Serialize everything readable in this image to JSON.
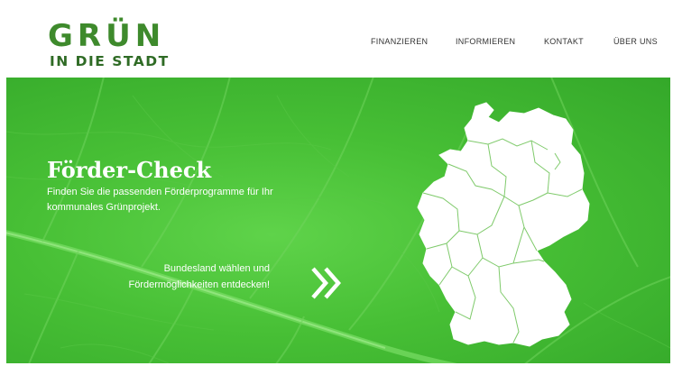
{
  "brand": {
    "line1": "GRÜN",
    "line2": "IN DIE STADT"
  },
  "nav": {
    "items": [
      "FINANZIEREN",
      "INFORMIEREN",
      "KONTAKT",
      "ÜBER UNS"
    ]
  },
  "hero": {
    "title": "Förder-Check",
    "subtitle": "Finden Sie die passenden Förderprogramme für Ihr kommunales Grünprojekt.",
    "cta_text": "Bundesland wählen und Fördermöglichkeiten entdecken!"
  },
  "icons": {
    "cta": "double-chevron-right-icon",
    "map": "germany-map-icon"
  },
  "colors": {
    "brand_green": "#3e8a2c",
    "hero_green": "#47bf35",
    "map_fill": "#ffffff",
    "map_borders": "#7fca6b"
  }
}
